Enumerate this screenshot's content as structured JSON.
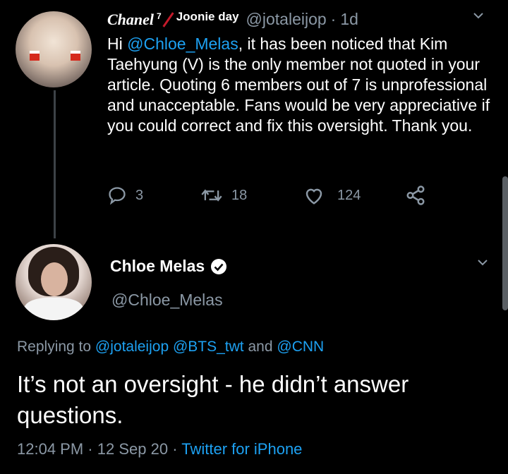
{
  "tweet1": {
    "display_name": "Chanel",
    "name_superscript": "7",
    "name_suffix": "Joonie day",
    "handle": "@jotaleijop",
    "time": "1d",
    "text_parts": [
      "Hi ",
      "@Chloe_Melas",
      ", it has been noticed that Kim Taehyung (V) is the only member not quoted in your article. Quoting 6 members out of 7 is unprofessional and unacceptable. Fans would be very appreciative if you could correct and fix this oversight. Thank you."
    ],
    "reply_count": "3",
    "retweet_count": "18",
    "like_count": "124"
  },
  "tweet2": {
    "display_name": "Chloe Melas",
    "handle": "@Chloe_Melas",
    "replying_prefix": "Replying to ",
    "replying_mention1": "@jotaleijop",
    "replying_mention2": "@BTS_twt",
    "replying_and": " and ",
    "replying_mention3": "@CNN",
    "text": "It’s not an oversight - he didn’t answer questions.",
    "time": "12:04 PM",
    "date": "12 Sep 20",
    "source": "Twitter for iPhone"
  },
  "colors": {
    "background": "#000000",
    "text": "#ffffff",
    "muted": "#8b98a5",
    "link": "#1da1f2",
    "thread_line": "#3d4247"
  },
  "icons": [
    "reply-icon",
    "retweet-icon",
    "like-icon",
    "share-icon",
    "verified-icon",
    "chevron-down-icon"
  ]
}
